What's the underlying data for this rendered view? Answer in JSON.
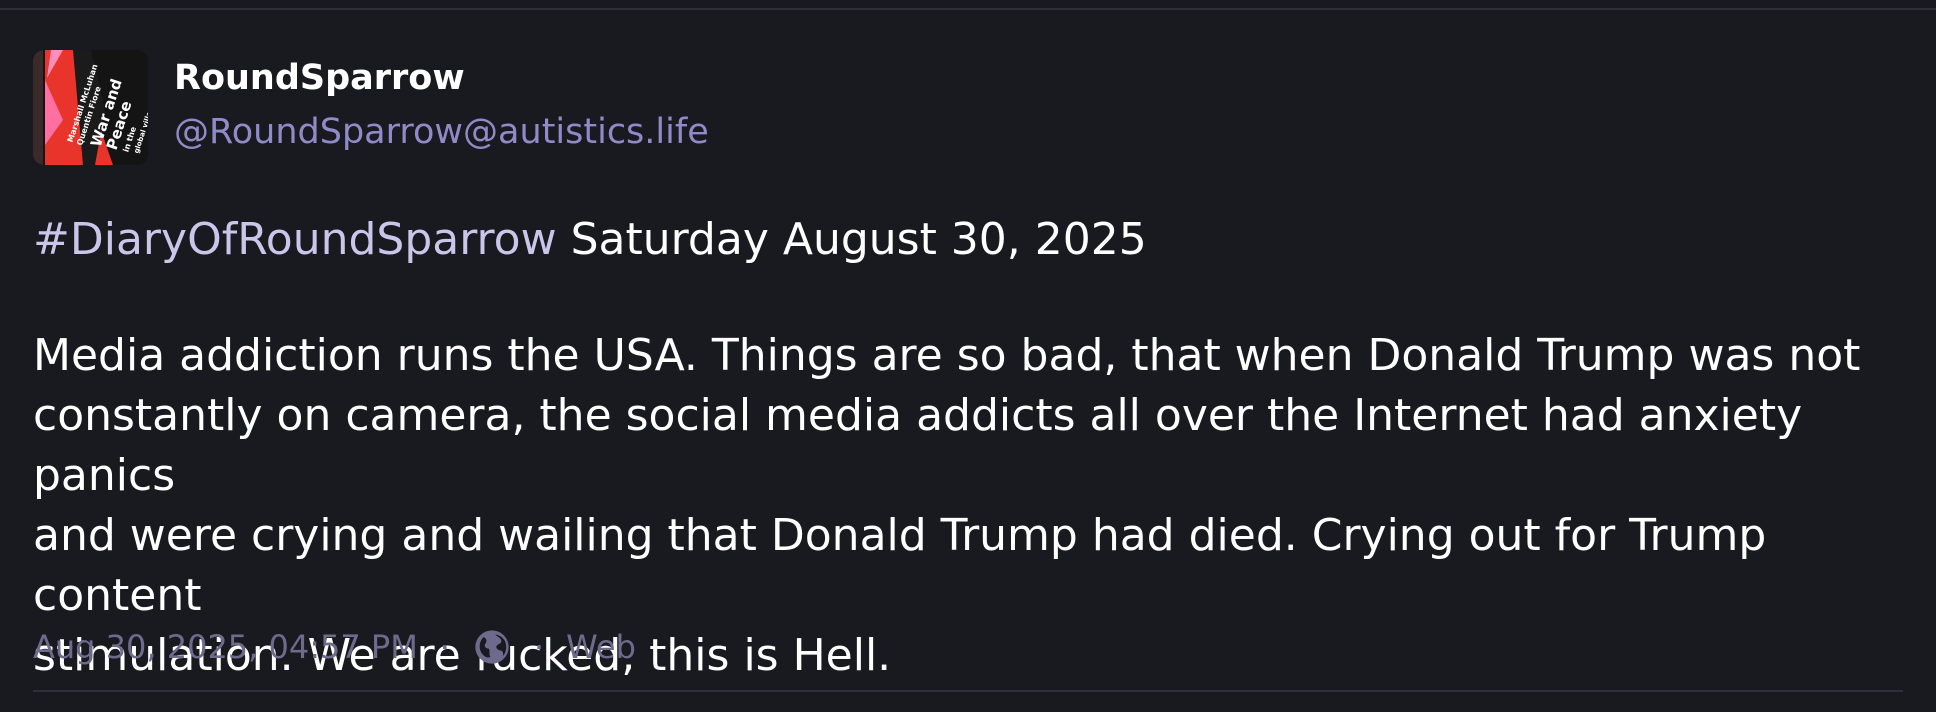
{
  "author": {
    "display_name": "RoundSparrow",
    "handle": "@RoundSparrow@autistics.life",
    "avatar": {
      "icon": "book-cover-avatar",
      "cover_text": [
        "Marshall McLuhan",
        "Quentin Fiore",
        "War and",
        "Peace",
        "in the",
        "global village"
      ]
    }
  },
  "post": {
    "hashtag": "#DiaryOfRoundSparrow",
    "date_line": "Saturday August 30, 2025",
    "body_lines": [
      "Media addiction runs the USA. Things are so bad, that when Donald Trump was not",
      "constantly on camera, the social media addicts all over the Internet had anxiety panics",
      "and were crying and wailing that Donald Trump had died. Crying out for Trump content",
      "stimulation. We are fucked, this is Hell."
    ]
  },
  "meta": {
    "timestamp": "Aug 30, 2025, 04:57 PM",
    "separator": "·",
    "visibility_icon": "globe-icon",
    "application": "Web"
  },
  "colors": {
    "background": "#191920",
    "text": "#ffffff",
    "handle": "#8f8bc7",
    "hashtag": "#cac6ea",
    "meta": "#6e6a8c",
    "divider": "#2f2f3b"
  }
}
